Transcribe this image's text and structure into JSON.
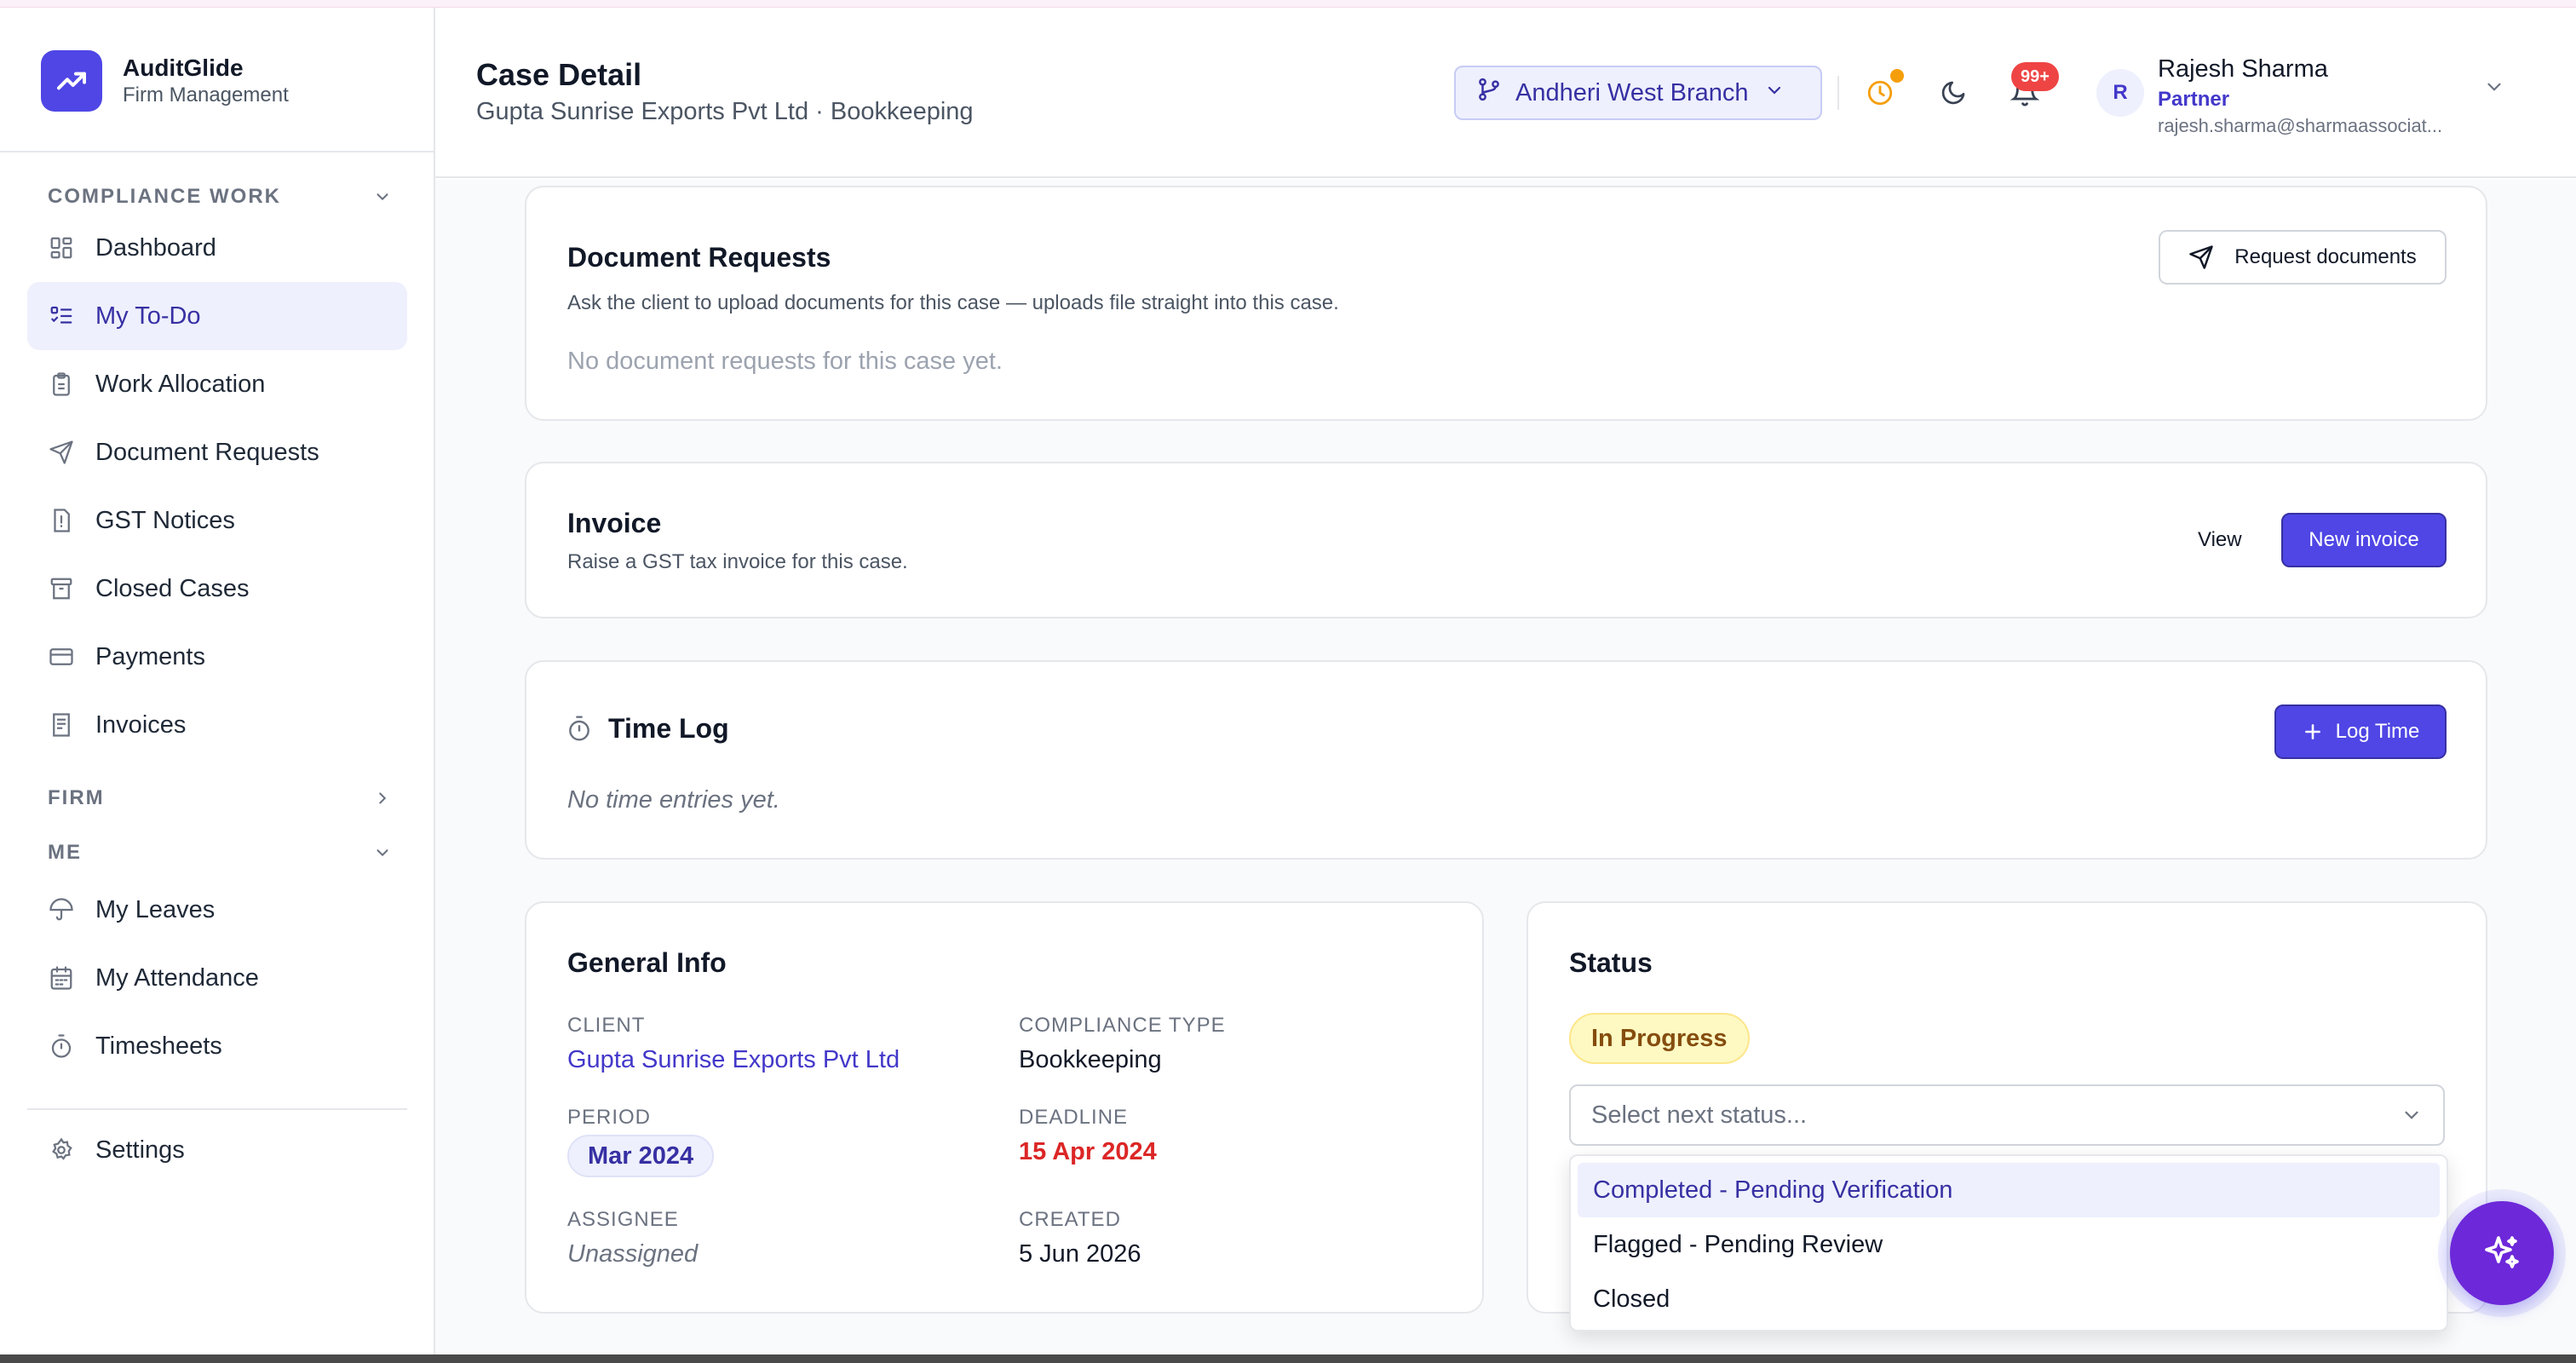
{
  "brand": {
    "name": "AuditGlide",
    "subtitle": "Firm Management"
  },
  "sidebar": {
    "sections": [
      {
        "label": "COMPLIANCE WORK",
        "expanded": true
      },
      {
        "label": "FIRM",
        "expanded": false
      },
      {
        "label": "ME",
        "expanded": true
      }
    ],
    "compliance_items": [
      {
        "label": "Dashboard",
        "icon": "dashboard-grid-icon"
      },
      {
        "label": "My To-Do",
        "icon": "checklist-icon",
        "active": true
      },
      {
        "label": "Work Allocation",
        "icon": "clipboard-icon"
      },
      {
        "label": "Document Requests",
        "icon": "send-icon"
      },
      {
        "label": "GST Notices",
        "icon": "notice-file-icon"
      },
      {
        "label": "Closed Cases",
        "icon": "archive-icon"
      },
      {
        "label": "Payments",
        "icon": "card-icon"
      },
      {
        "label": "Invoices",
        "icon": "receipt-icon"
      }
    ],
    "me_items": [
      {
        "label": "My Leaves",
        "icon": "umbrella-icon"
      },
      {
        "label": "My Attendance",
        "icon": "calendar-icon"
      },
      {
        "label": "Timesheets",
        "icon": "stopwatch-icon"
      }
    ],
    "settings": {
      "label": "Settings",
      "icon": "gear-icon"
    }
  },
  "header": {
    "title": "Case Detail",
    "subtitle": "Gupta Sunrise Exports Pvt Ltd · Bookkeeping",
    "branch": "Andheri West Branch",
    "notifications_badge": "99+",
    "user": {
      "initial": "R",
      "name": "Rajesh Sharma",
      "role": "Partner",
      "email": "rajesh.sharma@sharmaassociat..."
    }
  },
  "document_requests": {
    "title": "Document Requests",
    "description": "Ask the client to upload documents for this case — uploads file straight into this case.",
    "button": "Request documents",
    "empty": "No document requests for this case yet."
  },
  "invoice": {
    "title": "Invoice",
    "description": "Raise a GST tax invoice for this case.",
    "view": "View",
    "new": "New invoice"
  },
  "time_log": {
    "title": "Time Log",
    "button": "Log Time",
    "empty": "No time entries yet."
  },
  "general_info": {
    "title": "General Info",
    "client_label": "CLIENT",
    "client": "Gupta Sunrise Exports Pvt Ltd",
    "compliance_label": "COMPLIANCE TYPE",
    "compliance": "Bookkeeping",
    "period_label": "PERIOD",
    "period": "Mar 2024",
    "deadline_label": "DEADLINE",
    "deadline": "15 Apr 2024",
    "assignee_label": "ASSIGNEE",
    "assignee": "Unassigned",
    "created_label": "CREATED",
    "created": "5 Jun 2026"
  },
  "status": {
    "title": "Status",
    "current": "In Progress",
    "select_placeholder": "Select next status...",
    "options": [
      "Completed - Pending Verification",
      "Flagged - Pending Review",
      "Closed"
    ],
    "highlighted_option": 0
  },
  "colors": {
    "accent": "#4f46e5",
    "deadline": "#dc2626",
    "status_bg": "#fef9c3",
    "fab": "#6d28d9"
  }
}
